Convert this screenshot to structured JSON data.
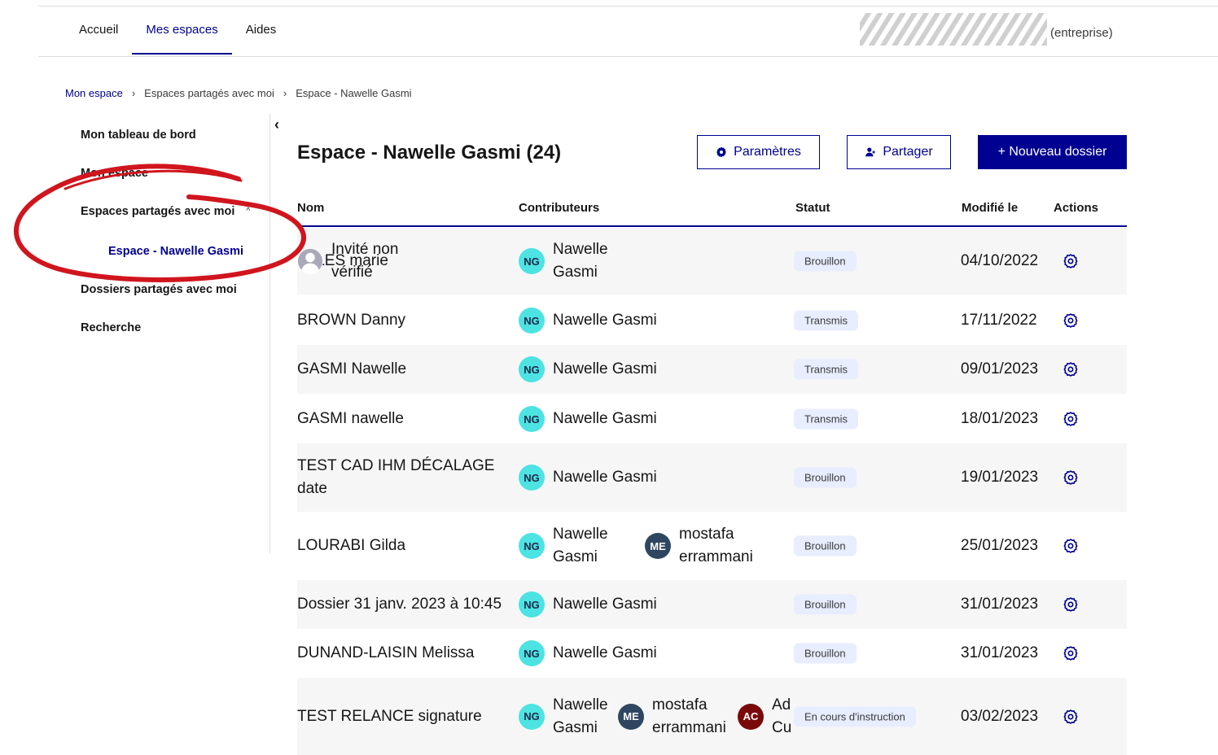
{
  "topnav": {
    "items": [
      "Accueil",
      "Mes espaces",
      "Aides"
    ],
    "active_index": 1
  },
  "account": {
    "company_label": "(entreprise)"
  },
  "breadcrumb": {
    "items": [
      "Mon espace",
      "Espaces partagés avec moi",
      "Espace - Nawelle Gasmi"
    ]
  },
  "sidebar": {
    "items": [
      "Mon tableau de bord",
      "Mon espace",
      "Espaces partagés avec moi",
      "Espace - Nawelle Gasmi",
      "Dossiers partagés avec moi",
      "Recherche"
    ],
    "collapse_glyph": "‹",
    "expand_glyph": "^"
  },
  "page": {
    "title": "Espace - Nawelle Gasmi (24)"
  },
  "buttons": {
    "settings": "Paramètres",
    "share": "Partager",
    "new_folder": "+ Nouveau dossier"
  },
  "table": {
    "headers": [
      "Nom",
      "Contributeurs",
      "Statut",
      "Modifié le",
      "Actions"
    ],
    "rows": [
      {
        "name": "JULES marie",
        "contributors": [
          {
            "initials": "NG",
            "name": "Nawelle Gasmi",
            "kind": "ng"
          },
          {
            "initials": "",
            "name": "Invité non vérifié",
            "kind": "user-icon"
          }
        ],
        "status": "Brouillon",
        "date": "04/10/2022"
      },
      {
        "name": "BROWN Danny",
        "contributors": [
          {
            "initials": "NG",
            "name": "Nawelle Gasmi",
            "kind": "ng"
          }
        ],
        "status": "Transmis",
        "date": "17/11/2022"
      },
      {
        "name": "GASMI Nawelle",
        "contributors": [
          {
            "initials": "NG",
            "name": "Nawelle Gasmi",
            "kind": "ng"
          }
        ],
        "status": "Transmis",
        "date": "09/01/2023"
      },
      {
        "name": "GASMI nawelle",
        "contributors": [
          {
            "initials": "NG",
            "name": "Nawelle Gasmi",
            "kind": "ng"
          }
        ],
        "status": "Transmis",
        "date": "18/01/2023"
      },
      {
        "name": "TEST CAD IHM DÉCALAGE date",
        "contributors": [
          {
            "initials": "NG",
            "name": "Nawelle Gasmi",
            "kind": "ng"
          }
        ],
        "status": "Brouillon",
        "date": "19/01/2023"
      },
      {
        "name": "LOURABI Gilda",
        "contributors": [
          {
            "initials": "NG",
            "name": "Nawelle Gasmi",
            "kind": "ng"
          },
          {
            "initials": "ME",
            "name": "mostafa errammani",
            "kind": "me"
          }
        ],
        "status": "Brouillon",
        "date": "25/01/2023"
      },
      {
        "name": "Dossier 31 janv. 2023 à 10:45",
        "contributors": [
          {
            "initials": "NG",
            "name": "Nawelle Gasmi",
            "kind": "ng"
          }
        ],
        "status": "Brouillon",
        "date": "31/01/2023"
      },
      {
        "name": "DUNAND-LAISIN Melissa",
        "contributors": [
          {
            "initials": "NG",
            "name": "Nawelle Gasmi",
            "kind": "ng"
          }
        ],
        "status": "Brouillon",
        "date": "31/01/2023"
      },
      {
        "name": "TEST RELANCE signature",
        "contributors": [
          {
            "initials": "NG",
            "name": "Nawelle Gasmi",
            "kind": "ng"
          },
          {
            "initials": "ME",
            "name": "mostafa errammani",
            "kind": "me"
          },
          {
            "initials": "AC",
            "name": "Ad Cu",
            "kind": "ac"
          }
        ],
        "status": "En cours d'instruction",
        "date": "03/02/2023"
      }
    ]
  },
  "colors": {
    "primary": "#000091",
    "badge_bg": "#e8edff",
    "ng_avatar": "#4de3e2",
    "me_avatar": "#2f4660",
    "ac_avatar": "#7a0a0a",
    "annotation": "#d0151e"
  },
  "icons": {
    "settings_button": "gear-icon",
    "share_button": "add-user-icon",
    "row_action": "gear-icon",
    "unverified_guest": "user-circle-icon"
  }
}
